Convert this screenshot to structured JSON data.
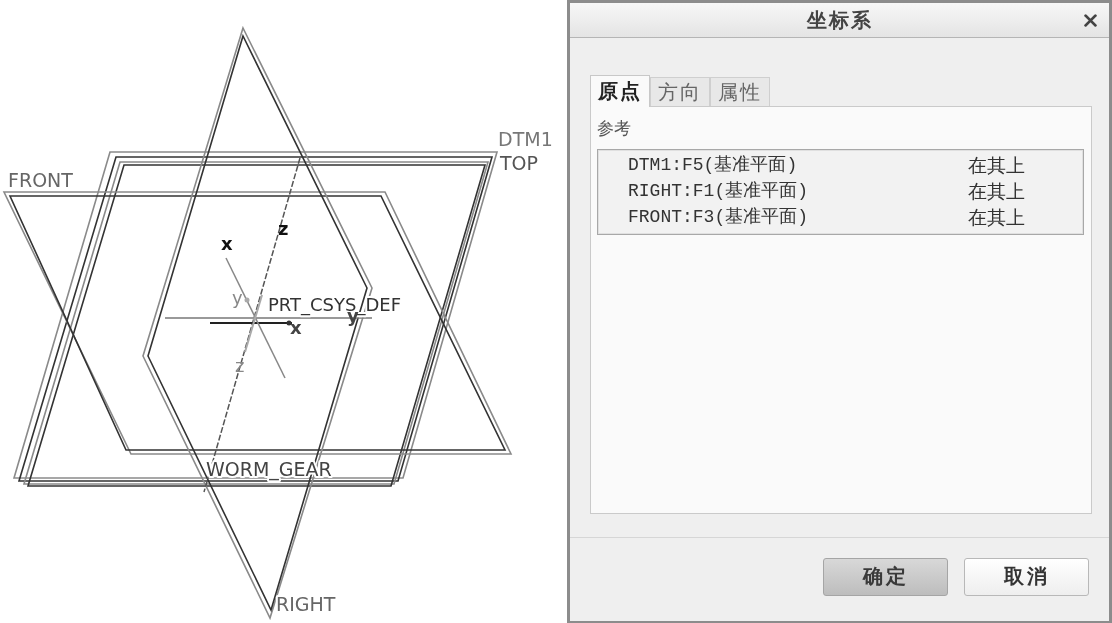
{
  "viewport": {
    "datum_planes": [
      {
        "label": "DTM1"
      },
      {
        "label": "TOP"
      },
      {
        "label": "FRONT"
      },
      {
        "label": "RIGHT"
      }
    ],
    "coordinate_system": {
      "label": "PRT_CSYS_DEF",
      "axis_labels": [
        "x",
        "z",
        "y",
        "x",
        "y",
        "z"
      ]
    },
    "part_label": "WORM_GEAR"
  },
  "dialog": {
    "title": "坐标系",
    "tabs": [
      {
        "label": "原点",
        "selected": true
      },
      {
        "label": "方向",
        "selected": false
      },
      {
        "label": "属性",
        "selected": false
      }
    ],
    "references": {
      "label": "参考",
      "rows": [
        {
          "reference": "DTM1:F5(基准平面)",
          "constraint": "在其上"
        },
        {
          "reference": "RIGHT:F1(基准平面)",
          "constraint": "在其上"
        },
        {
          "reference": "FRONT:F3(基准平面)",
          "constraint": "在其上"
        }
      ]
    },
    "buttons": [
      {
        "label": "确定",
        "default": true
      },
      {
        "label": "取消",
        "default": false
      }
    ]
  }
}
